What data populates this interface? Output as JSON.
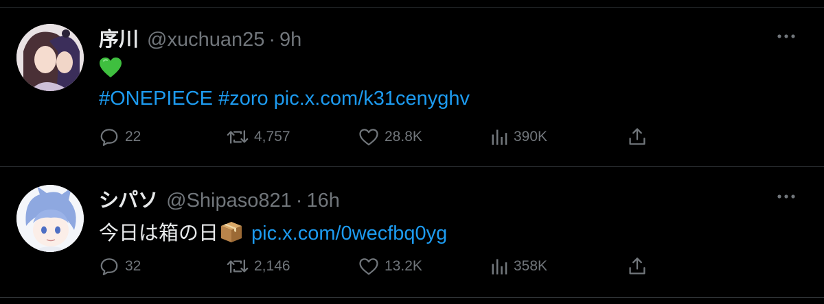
{
  "tweets": [
    {
      "display_name": "序川",
      "handle": "@xuchuan25",
      "separator": "·",
      "time": "9h",
      "emoji_line": "green-heart-emoji",
      "hashtags": [
        "#ONEPIECE",
        "#zoro"
      ],
      "link": "pic.x.com/k31cenyghv",
      "stats": {
        "replies": "22",
        "reposts": "4,757",
        "likes": "28.8K",
        "views": "390K"
      }
    },
    {
      "display_name": "シパソ",
      "handle": "@Shipaso821",
      "separator": "·",
      "time": "16h",
      "text": "今日は箱の日",
      "emoji": "package-emoji",
      "link": "pic.x.com/0wecfbq0yg",
      "stats": {
        "replies": "32",
        "reposts": "2,146",
        "likes": "13.2K",
        "views": "358K"
      }
    }
  ],
  "colors": {
    "background": "#000000",
    "text": "#e7e9ea",
    "secondary": "#71767b",
    "link": "#1d9bf0",
    "divider": "#2f3336",
    "heart_emoji": "#3fbf3f"
  },
  "icons": [
    "reply-icon",
    "repost-icon",
    "like-icon",
    "views-icon",
    "share-icon",
    "more-icon"
  ]
}
